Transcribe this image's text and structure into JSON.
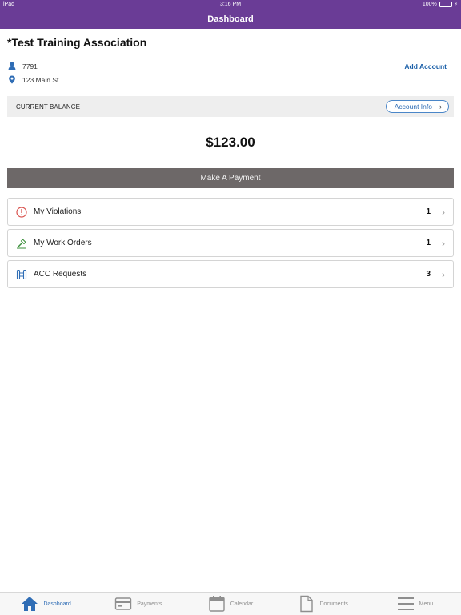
{
  "status_bar": {
    "device": "iPad",
    "time": "3:16 PM",
    "battery": "100%"
  },
  "nav": {
    "title": "Dashboard"
  },
  "association": {
    "name": "*Test Training Association"
  },
  "account": {
    "number": "7791",
    "address": "123 Main St",
    "add_account_label": "Add Account"
  },
  "balance": {
    "label": "CURRENT BALANCE",
    "account_info_label": "Account Info",
    "amount": "$123.00"
  },
  "payment": {
    "button_label": "Make A Payment"
  },
  "items": [
    {
      "label": "My Violations",
      "count": "1",
      "icon": "alert-circle-icon"
    },
    {
      "label": "My Work Orders",
      "count": "1",
      "icon": "wrench-icon"
    },
    {
      "label": "ACC Requests",
      "count": "3",
      "icon": "architecture-icon"
    }
  ],
  "tabs": [
    {
      "label": "Dashboard",
      "icon": "home-icon",
      "active": true
    },
    {
      "label": "Payments",
      "icon": "credit-card-icon",
      "active": false
    },
    {
      "label": "Calendar",
      "icon": "calendar-icon",
      "active": false
    },
    {
      "label": "Documents",
      "icon": "document-icon",
      "active": false
    },
    {
      "label": "Menu",
      "icon": "hamburger-menu-icon",
      "active": false
    }
  ],
  "colors": {
    "brand": "#6a3c96",
    "accent": "#2f6db5",
    "payment_button": "#6d6868",
    "alert": "#d9534f",
    "work_order": "#3a8f3a"
  }
}
